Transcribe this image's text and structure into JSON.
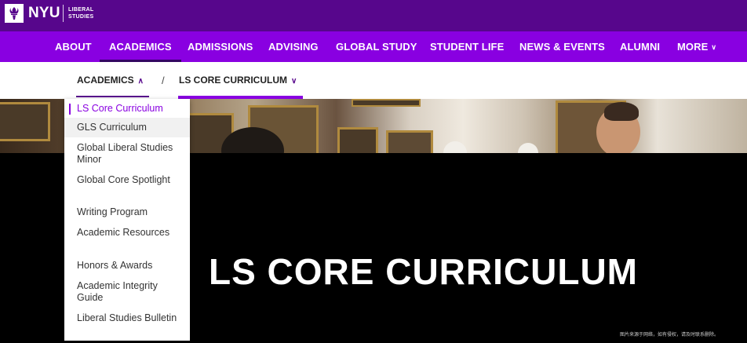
{
  "brand": {
    "name": "NYU",
    "sub_line1": "LIBERAL",
    "sub_line2": "STUDIES",
    "logo_icon": "torch-icon",
    "colors": {
      "brand_purple": "#57068c",
      "nav_purple": "#8900e1"
    }
  },
  "main_nav": {
    "items": [
      {
        "label": "ABOUT"
      },
      {
        "label": "ACADEMICS"
      },
      {
        "label": "ADMISSIONS"
      },
      {
        "label": "ADVISING"
      },
      {
        "label": "GLOBAL STUDY"
      },
      {
        "label": "STUDENT LIFE"
      },
      {
        "label": "NEWS & EVENTS"
      },
      {
        "label": "ALUMNI"
      },
      {
        "label": "MORE"
      }
    ],
    "active": "ACADEMICS"
  },
  "breadcrumb": {
    "parent": "ACADEMICS",
    "separator": "/",
    "current": "LS CORE CURRICULUM"
  },
  "dropdown": {
    "items": [
      {
        "label": "LS Core Curriculum"
      },
      {
        "label": "GLS Curriculum"
      },
      {
        "label": "Global Liberal Studies Minor"
      },
      {
        "label": "Global Core Spotlight"
      },
      {
        "label": "Writing Program"
      },
      {
        "label": "Academic Resources"
      },
      {
        "label": "Honors & Awards"
      },
      {
        "label": "Academic Integrity Guide"
      },
      {
        "label": "Liberal Studies Bulletin"
      }
    ],
    "selected": "LS Core Curriculum",
    "hovered": "GLS Curriculum"
  },
  "hero": {
    "title": "LS CORE CURRICULUM",
    "caption": "图片来源于网络，如有侵权，请及时联系删除。"
  }
}
